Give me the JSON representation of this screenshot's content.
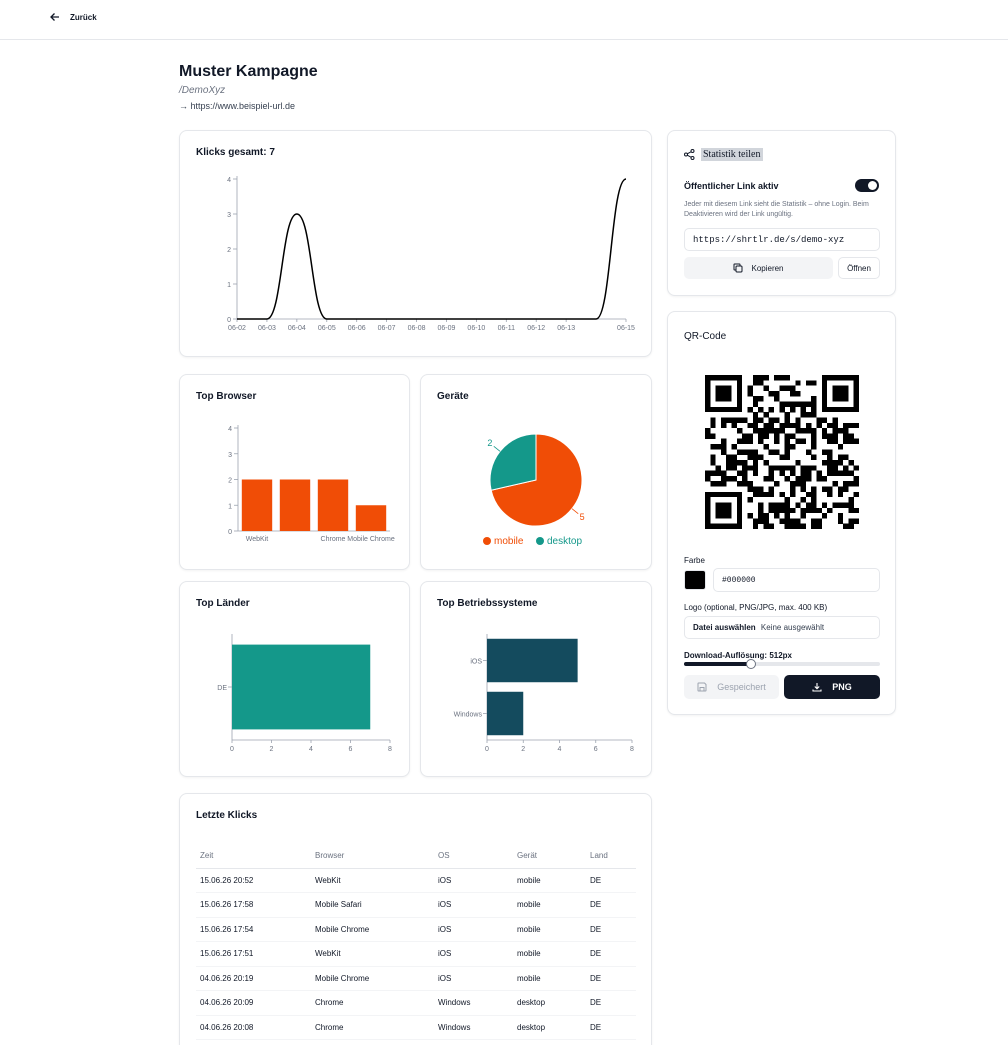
{
  "nav": {
    "back_label": "Zurück"
  },
  "campaign": {
    "title": "Muster Kampagne",
    "slug": "/DemoXyz",
    "target": "→ https://www.beispiel-url.de"
  },
  "clicks_chart": {
    "title": "Klicks gesamt: 7",
    "chart_data": {
      "type": "line",
      "x": [
        "06-02",
        "06-03",
        "06-04",
        "06-05",
        "06-06",
        "06-07",
        "06-08",
        "06-09",
        "06-10",
        "06-11",
        "06-12",
        "06-13",
        "06-14",
        "06-15"
      ],
      "x_tick_labels": [
        "06-02",
        "06-03",
        "06-04",
        "06-05",
        "06-06",
        "06-07",
        "06-08",
        "06-09",
        "06-10",
        "06-11",
        "06-12",
        "06-13",
        "06-15"
      ],
      "series": [
        {
          "values": [
            0,
            0,
            3,
            0,
            0,
            0,
            0,
            0,
            0,
            0,
            0,
            0,
            0,
            4
          ]
        }
      ],
      "ylim": [
        0,
        4
      ],
      "y_ticks": [
        "0",
        "1",
        "2",
        "3",
        "4"
      ],
      "line_color": "#000000"
    }
  },
  "browser_chart": {
    "title": "Top Browser",
    "chart_data": {
      "type": "bar",
      "categories": [
        "WebKit",
        "Mobile Safari",
        "Chrome",
        "Mobile Chrome"
      ],
      "category_tick_labels": [
        "WebKit",
        "",
        "Chrome",
        "Mobile Chrome"
      ],
      "values": [
        2,
        2,
        2,
        1
      ],
      "ylim": [
        0,
        4
      ],
      "y_ticks": [
        "0",
        "1",
        "2",
        "3",
        "4"
      ],
      "color": "#f04d06"
    }
  },
  "devices_chart": {
    "title": "Geräte",
    "chart_data": {
      "type": "pie",
      "labels": [
        "mobile",
        "desktop"
      ],
      "values": [
        5,
        2
      ],
      "colors": [
        "#f04d06",
        "#14988a"
      ],
      "value_labels": [
        "5",
        "2"
      ],
      "legend_position": "bottom"
    }
  },
  "countries_chart": {
    "title": "Top Länder",
    "chart_data": {
      "type": "bar",
      "orientation": "horizontal",
      "categories": [
        "DE"
      ],
      "values": [
        7
      ],
      "xlim": [
        0,
        8
      ],
      "x_ticks": [
        "0",
        "2",
        "4",
        "6",
        "8"
      ],
      "color": "#14988a"
    }
  },
  "os_chart": {
    "title": "Top Betriebssysteme",
    "chart_data": {
      "type": "bar",
      "orientation": "horizontal",
      "categories": [
        "iOS",
        "Windows"
      ],
      "values": [
        5,
        2
      ],
      "xlim": [
        0,
        8
      ],
      "x_ticks": [
        "0",
        "2",
        "4",
        "6",
        "8"
      ],
      "color": "#144b5e"
    }
  },
  "share": {
    "title": "Statistik teilen",
    "toggle_label": "Öffentlicher Link aktiv",
    "toggle_on": true,
    "note": "Jeder mit diesem Link sieht die Statistik – ohne Login. Beim Deaktivieren wird der Link ungültig.",
    "url": "https://shrtlr.de/s/demo-xyz",
    "copy_label": "Kopieren",
    "open_label": "Öffnen"
  },
  "qr": {
    "title": "QR-Code",
    "color_label": "Farbe",
    "color_value": "#000000",
    "logo_label": "Logo (optional, PNG/JPG, max. 400 KB)",
    "file_button": "Datei auswählen",
    "file_status": "Keine ausgewählt",
    "resolution_label": "Download-Auflösung: 512px",
    "resolution_fraction": 0.34,
    "saved_label": "Gespeichert",
    "png_label": "PNG"
  },
  "recent": {
    "title": "Letzte Klicks",
    "columns": [
      "Zeit",
      "Browser",
      "OS",
      "Gerät",
      "Land"
    ],
    "rows": [
      [
        "15.06.26 20:52",
        "WebKit",
        "iOS",
        "mobile",
        "DE"
      ],
      [
        "15.06.26 17:58",
        "Mobile Safari",
        "iOS",
        "mobile",
        "DE"
      ],
      [
        "15.06.26 17:54",
        "Mobile Chrome",
        "iOS",
        "mobile",
        "DE"
      ],
      [
        "15.06.26 17:51",
        "WebKit",
        "iOS",
        "mobile",
        "DE"
      ],
      [
        "04.06.26 20:19",
        "Mobile Chrome",
        "iOS",
        "mobile",
        "DE"
      ],
      [
        "04.06.26 20:09",
        "Chrome",
        "Windows",
        "desktop",
        "DE"
      ],
      [
        "04.06.26 20:08",
        "Chrome",
        "Windows",
        "desktop",
        "DE"
      ]
    ]
  }
}
